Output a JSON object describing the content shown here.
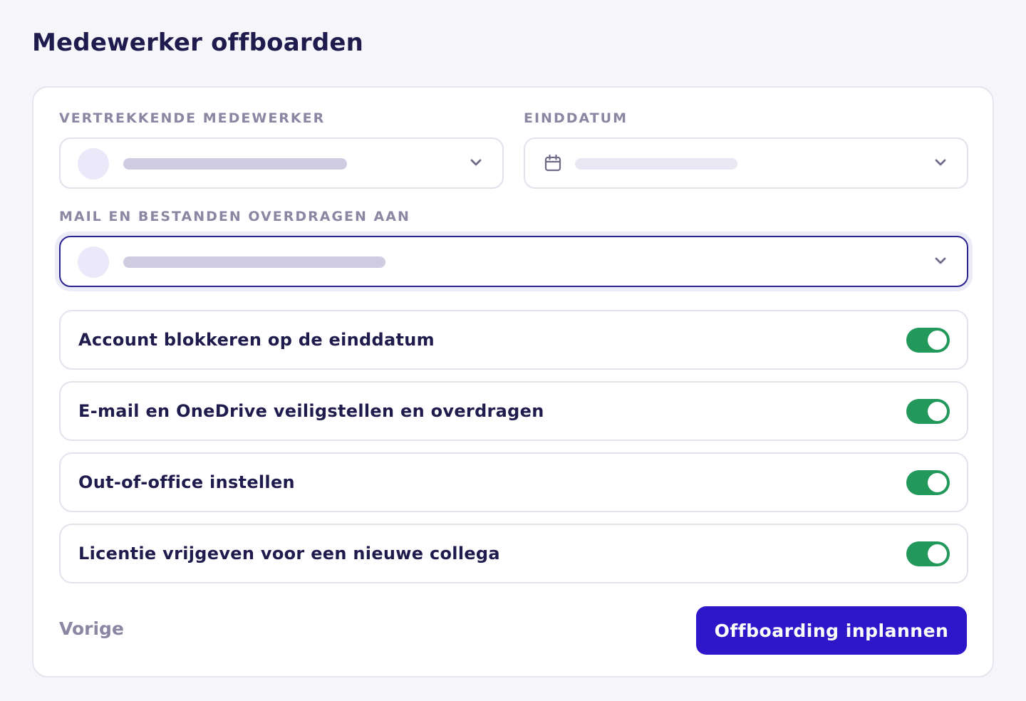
{
  "page": {
    "title": "Medewerker offboarden"
  },
  "form": {
    "departing_employee": {
      "label": "VERTREKKENDE MEDEWERKER",
      "icon": "chevron-down-icon"
    },
    "end_date": {
      "label": "EINDDATUM",
      "icon": "calendar-icon"
    },
    "transfer_to": {
      "label": "MAIL EN BESTANDEN OVERDRAGEN AAN",
      "icon": "chevron-down-icon",
      "state": "focused"
    },
    "options": [
      {
        "label": "Account blokkeren op de einddatum",
        "enabled": true
      },
      {
        "label": "E-mail en OneDrive veiligstellen en overdragen",
        "enabled": true
      },
      {
        "label": "Out-of-office instellen",
        "enabled": true
      },
      {
        "label": "Licentie vrijgeven voor een nieuwe collega",
        "enabled": true
      }
    ]
  },
  "footer": {
    "back_label": "Vorige",
    "submit_label": "Offboarding inplannen"
  },
  "colors": {
    "primary": "#2d17c9",
    "toggle_on": "#22995a",
    "heading": "#1f1b4d",
    "muted": "#8a87a3",
    "focus_border": "#2a2390"
  }
}
